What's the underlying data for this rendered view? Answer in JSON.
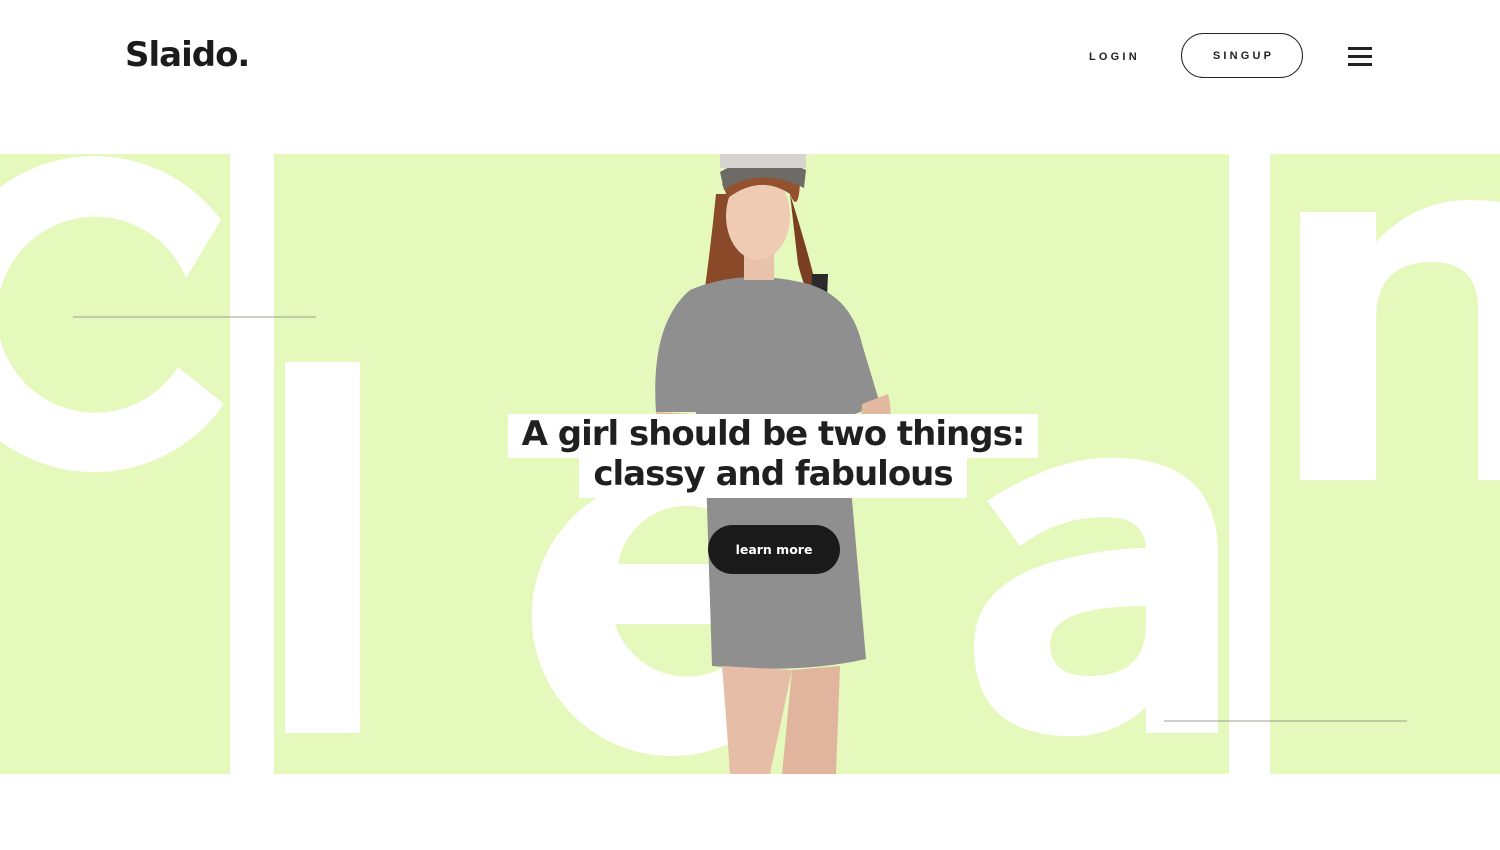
{
  "header": {
    "logo": "Slaido.",
    "login_label": "LOGIN",
    "signup_label": "SINGUP",
    "menu_icon": "hamburger-menu-icon"
  },
  "hero": {
    "background_word": [
      "c",
      "l",
      "e",
      "a",
      "n"
    ],
    "headline_line1": "A girl should be two things:",
    "headline_line2": "classy and fabulous",
    "cta_label": "learn more",
    "accent_color": "#e6f9bd"
  }
}
